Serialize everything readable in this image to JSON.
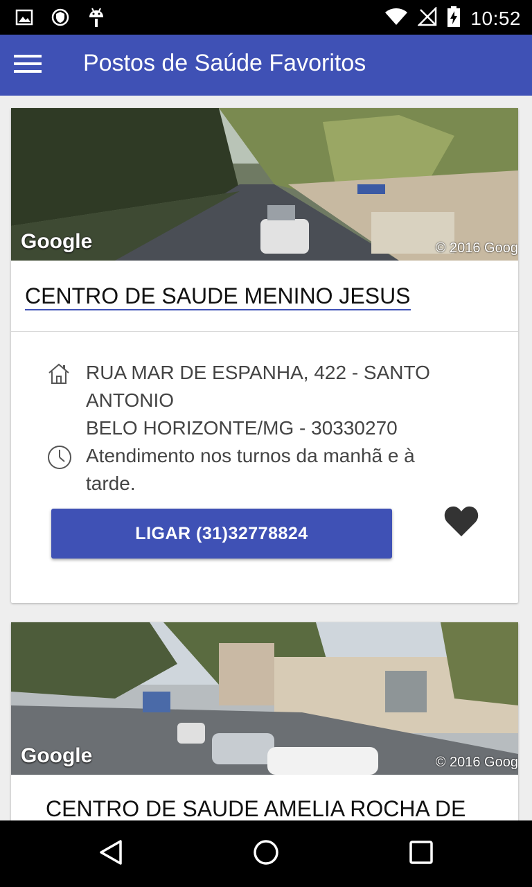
{
  "status_bar": {
    "time": "10:52",
    "icons": [
      "image-icon",
      "shield-icon",
      "android-icon",
      "wifi-icon",
      "no-signal-icon",
      "battery-charging-icon"
    ]
  },
  "app_bar": {
    "title": "Postos de Saúde Favoritos",
    "menu_icon": "hamburger-menu-icon"
  },
  "cards": [
    {
      "image_google_label": "Google",
      "image_copyright": "© 2016 Goog",
      "title": "CENTRO DE SAUDE MENINO JESUS",
      "address_line1": "RUA MAR DE ESPANHA, 422 - SANTO",
      "address_line2": "ANTONIO",
      "address_line3": "BELO HORIZONTE/MG - 30330270",
      "hours_line1": "Atendimento nos turnos da manhã e à",
      "hours_line2": "tarde.",
      "call_label": "LIGAR (31)32778824",
      "favorite_icon": "heart-icon"
    },
    {
      "image_google_label": "Google",
      "image_copyright": "© 2016 Goog",
      "title": "CENTRO DE SAUDE AMELIA ROCHA DE"
    }
  ],
  "nav_bar": {
    "icons": [
      "back-icon",
      "home-icon",
      "recents-icon"
    ]
  },
  "colors": {
    "primary": "#3f51b5",
    "background": "#eeeeee",
    "status_bar": "#000000"
  }
}
